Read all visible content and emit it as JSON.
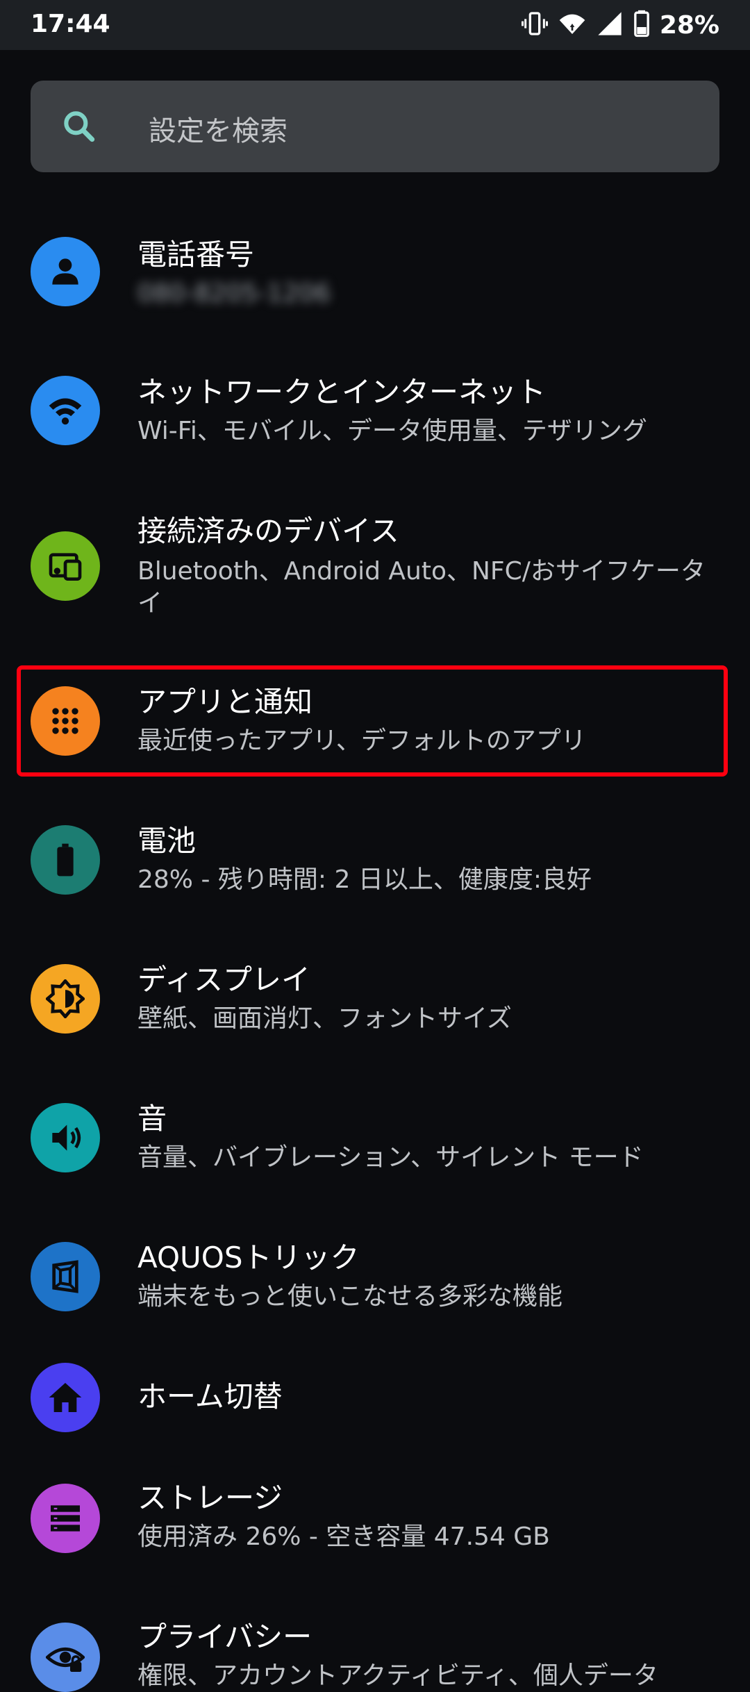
{
  "status_bar": {
    "time": "17:44",
    "battery_percent": "28%"
  },
  "search": {
    "placeholder": "設定を検索"
  },
  "settings": {
    "items": [
      {
        "title": "電話番号",
        "subtitle": "080-8205-1206",
        "icon": "person-icon",
        "color": "#2a8cf0"
      },
      {
        "title": "ネットワークとインターネット",
        "subtitle": "Wi-Fi、モバイル、データ使用量、テザリング",
        "icon": "wifi-icon",
        "color": "#2a8cf0"
      },
      {
        "title": "接続済みのデバイス",
        "subtitle": "Bluetooth、Android Auto、NFC/おサイフケータイ",
        "icon": "devices-icon",
        "color": "#6fb51b"
      },
      {
        "title": "アプリと通知",
        "subtitle": "最近使ったアプリ、デフォルトのアプリ",
        "icon": "apps-grid-icon",
        "color": "#f5821f"
      },
      {
        "title": "電池",
        "subtitle": "28% - 残り時間: 2 日以上、健康度:良好",
        "icon": "battery-icon",
        "color": "#1c7d72"
      },
      {
        "title": "ディスプレイ",
        "subtitle": "壁紙、画面消灯、フォントサイズ",
        "icon": "brightness-icon",
        "color": "#f5a623"
      },
      {
        "title": "音",
        "subtitle": "音量、バイブレーション、サイレント モード",
        "icon": "volume-icon",
        "color": "#0fa3a8"
      },
      {
        "title": "AQUOSトリック",
        "subtitle": "端末をもっと使いこなせる多彩な機能",
        "icon": "aquos-trick-icon",
        "color": "#1e73c8"
      },
      {
        "title": "ホーム切替",
        "subtitle": "",
        "icon": "home-icon",
        "color": "#4a3ff0"
      },
      {
        "title": "ストレージ",
        "subtitle": "使用済み 26% - 空き容量 47.54 GB",
        "icon": "storage-icon",
        "color": "#b548d8"
      },
      {
        "title": "プライバシー",
        "subtitle": "権限、アカウントアクティビティ、個人データ",
        "icon": "privacy-icon",
        "color": "#5a8de8"
      }
    ]
  },
  "colors": {
    "background": "#0b0c0f",
    "status_bar": "#1d2024",
    "search_box": "#3d4044",
    "search_icon": "#7fd1c5",
    "highlight": "#ff0010"
  }
}
